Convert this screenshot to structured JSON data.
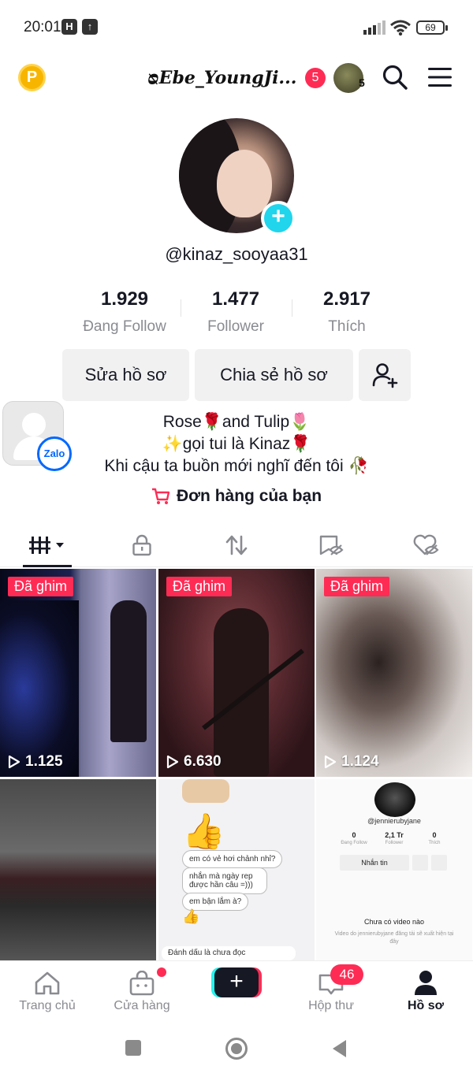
{
  "status_bar": {
    "time": "20:01",
    "app_icon_1": "H",
    "app_icon_2": "↑",
    "battery": "69"
  },
  "top_nav": {
    "coin_label": "P",
    "username": "ᴓEbe_YoungJi...",
    "notification_count": "5",
    "friends_count": "5"
  },
  "profile": {
    "handle": "@kinaz_sooyaa31",
    "stats": [
      {
        "value": "1.929",
        "label": "Đang Follow"
      },
      {
        "value": "1.477",
        "label": "Follower"
      },
      {
        "value": "2.917",
        "label": "Thích"
      }
    ],
    "edit_button": "Sửa hồ sơ",
    "share_button": "Chia sẻ hồ sơ",
    "bio_lines": [
      "Rose🌹and Tulip🌷",
      "✨gọi tui là Kinaz🌹",
      "Khi cậu ta buồn mới nghĩ đến tôi 🥀"
    ],
    "orders_label": "Đơn hàng của bạn"
  },
  "zalo": {
    "label": "Zalo"
  },
  "videos": [
    {
      "pinned": "Đã ghim",
      "views": "1.125"
    },
    {
      "pinned": "Đã ghim",
      "views": "6.630"
    },
    {
      "pinned": "Đã ghim",
      "views": "1.124"
    }
  ],
  "thumb_text": {
    "chat": [
      "em có vẻ hơi chảnh nhỉ?",
      "nhắn mà ngày rep được hần câu =)))",
      "em bận lắm à?"
    ],
    "chat_footer": "Đánh dấu là chưa đọc",
    "mini_handle": "@jennierubyjane",
    "mini_stats": [
      "0",
      "2,1 Tr",
      "0"
    ],
    "mini_labels": [
      "Đang Follow",
      "Follower",
      "Thích"
    ],
    "mini_message": "Nhắn tin",
    "mini_empty_title": "Chưa có video nào",
    "mini_empty_desc": "Video do jennierubyjane đăng tải sẽ xuất hiện tại đây"
  },
  "bottom_nav": {
    "items": [
      "Trang chủ",
      "Cửa hàng",
      "",
      "Hộp thư",
      "Hồ sơ"
    ],
    "inbox_count": "46"
  },
  "colors": {
    "accent": "#fe2c55",
    "teal": "#20d5ec",
    "text": "#161823",
    "muted": "#8a8b91"
  }
}
